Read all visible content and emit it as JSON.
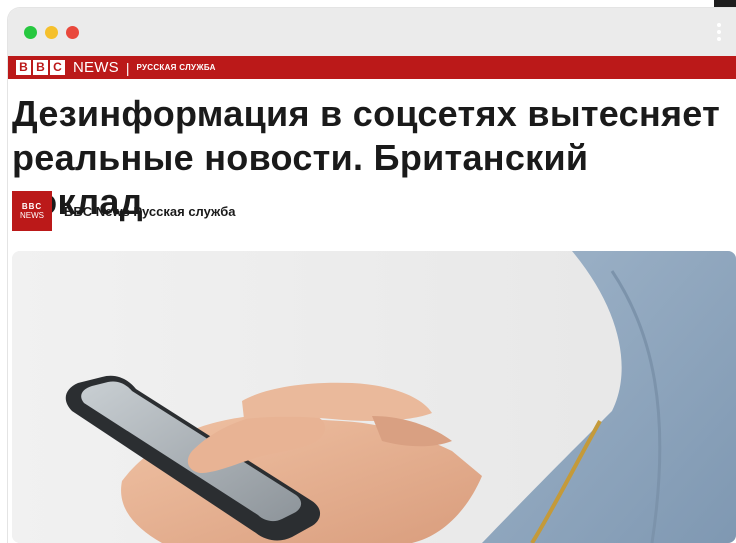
{
  "window": {
    "controls": [
      "green",
      "yellow",
      "red"
    ],
    "control_colors": {
      "green": "#27c840",
      "yellow": "#f5c02c",
      "red": "#e9483c"
    },
    "menu_icon": "kebab-menu-icon"
  },
  "masthead": {
    "logo_letters": [
      "B",
      "B",
      "C"
    ],
    "news": "NEWS",
    "separator": "|",
    "service": "РУССКАЯ СЛУЖБА",
    "color": "#bb1919"
  },
  "article": {
    "headline": "Дезинформация в соцсетях вытесняет реальные новости. Британский доклад",
    "author": {
      "logo_line1": "BBC",
      "logo_line2": "NEWS",
      "name": "BBC News Русская служба"
    },
    "hero_image": "hands-holding-smartphone-image"
  }
}
